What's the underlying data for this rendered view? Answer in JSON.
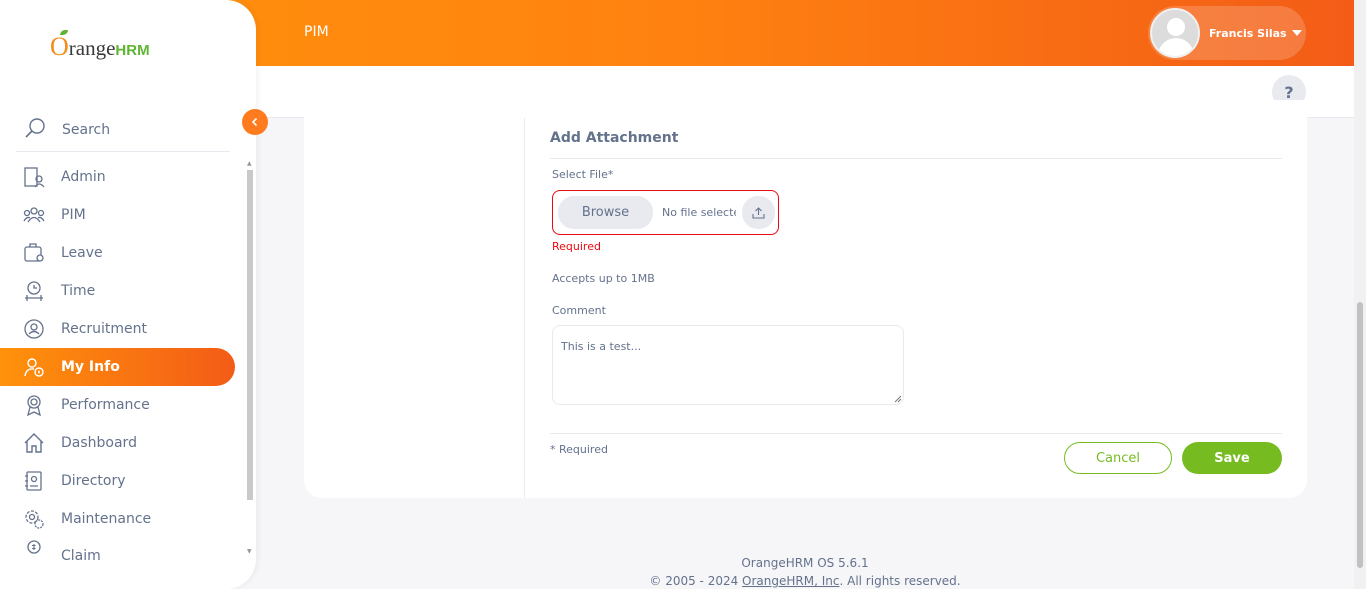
{
  "header": {
    "module_title": "PIM",
    "user_name": "Francis Silas",
    "help_label": "?"
  },
  "sidebar": {
    "logo": {
      "o": "O",
      "range": "range",
      "hrm": "HRM"
    },
    "search_label": "Search",
    "items": [
      {
        "label": "Admin",
        "icon": "admin-icon"
      },
      {
        "label": "PIM",
        "icon": "pim-icon"
      },
      {
        "label": "Leave",
        "icon": "leave-icon"
      },
      {
        "label": "Time",
        "icon": "time-icon"
      },
      {
        "label": "Recruitment",
        "icon": "recruitment-icon"
      },
      {
        "label": "My Info",
        "icon": "my-info-icon",
        "active": true
      },
      {
        "label": "Performance",
        "icon": "performance-icon"
      },
      {
        "label": "Dashboard",
        "icon": "dashboard-icon"
      },
      {
        "label": "Directory",
        "icon": "directory-icon"
      },
      {
        "label": "Maintenance",
        "icon": "maintenance-icon"
      },
      {
        "label": "Claim",
        "icon": "claim-icon"
      }
    ]
  },
  "form": {
    "title": "Add Attachment",
    "select_file_label": "Select File*",
    "browse_label": "Browse",
    "file_name": "No file selected",
    "error_text": "Required",
    "hint": "Accepts up to 1MB",
    "comment_label": "Comment",
    "comment_value": "This is a test...",
    "required_note": "* Required",
    "cancel_label": "Cancel",
    "save_label": "Save"
  },
  "footer": {
    "version": "OrangeHRM OS 5.6.1",
    "copyright_prefix": "© 2005 - 2024 ",
    "company_link": "OrangeHRM, Inc",
    "copyright_suffix": ". All rights reserved."
  },
  "colors": {
    "brand_orange": "#ff7b1d",
    "brand_green": "#76bc21",
    "error_red": "#eb0910",
    "text_gray": "#64728c"
  }
}
